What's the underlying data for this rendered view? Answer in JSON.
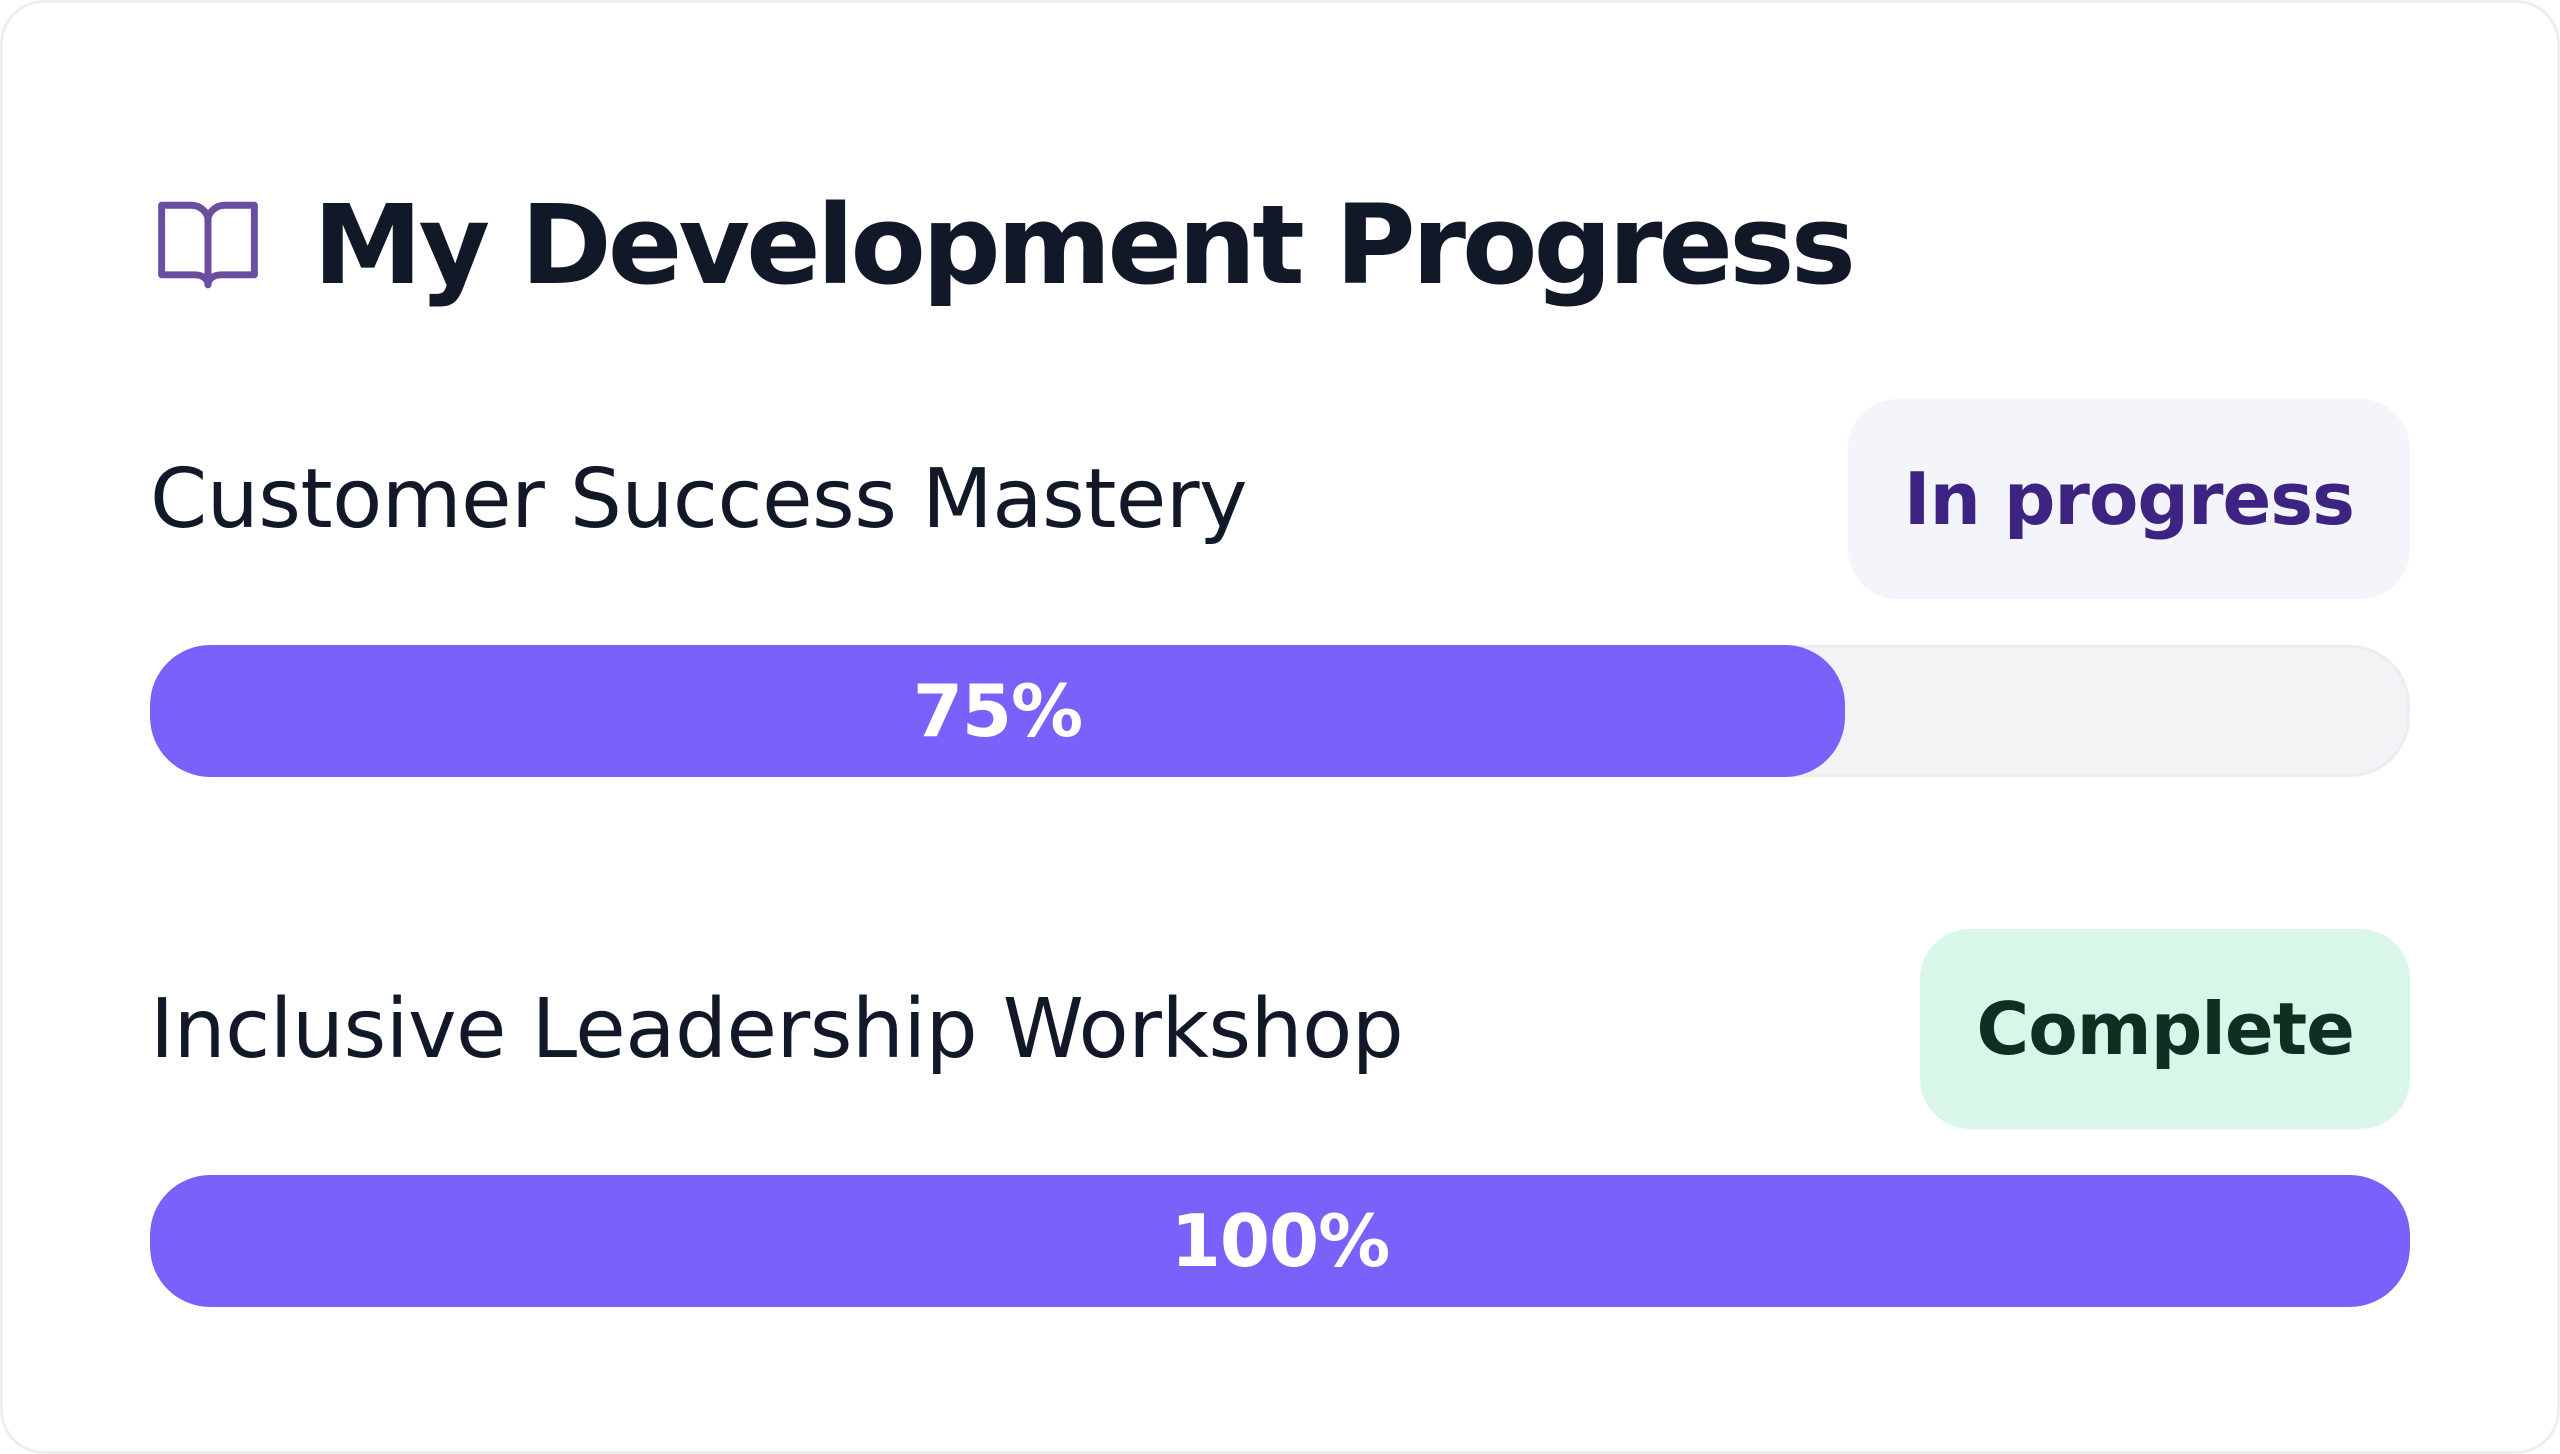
{
  "header": {
    "icon": "book-open-icon",
    "title": "My Development Progress"
  },
  "courses": [
    {
      "name": "Customer Success Mastery",
      "status": "In progress",
      "progress_percent": 75,
      "progress_label": "75%"
    },
    {
      "name": "Inclusive Leadership Workshop",
      "status": "Complete",
      "progress_percent": 100,
      "progress_label": "100%"
    }
  ],
  "colors": {
    "accent": "#7862fa",
    "icon": "#6b4ea0",
    "in_progress_badge_bg": "#f4f4fb",
    "in_progress_badge_text": "#3d2483",
    "complete_badge_bg": "#d9f7e8",
    "complete_badge_text": "#0f2f22",
    "track": "#f2f3f5"
  }
}
